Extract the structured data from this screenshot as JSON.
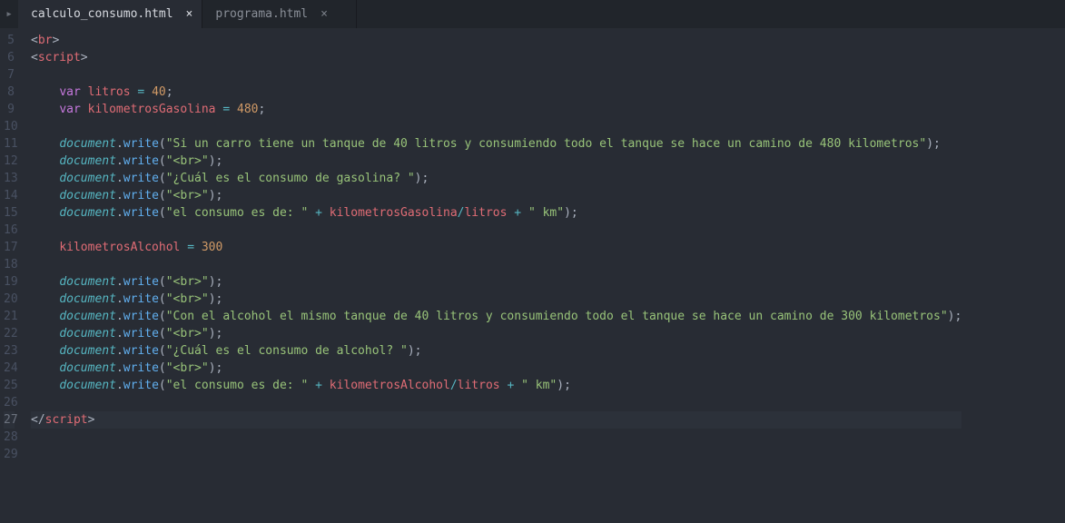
{
  "tabs": {
    "indicator": "▸",
    "items": [
      {
        "label": "calculo_consumo.html",
        "active": true
      },
      {
        "label": "programa.html",
        "active": false
      }
    ],
    "closeGlyph": "×"
  },
  "editor": {
    "startLine": 5,
    "currentLine": 27,
    "lines": [
      {
        "n": 5,
        "tokens": [
          [
            "br",
            "<"
          ],
          [
            "tg",
            "br"
          ],
          [
            "br",
            ">"
          ]
        ]
      },
      {
        "n": 6,
        "tokens": [
          [
            "br",
            "<"
          ],
          [
            "tg",
            "script"
          ],
          [
            "br",
            ">"
          ]
        ]
      },
      {
        "n": 7,
        "tokens": []
      },
      {
        "n": 8,
        "tokens": [
          [
            "p",
            "    "
          ],
          [
            "kw",
            "var"
          ],
          [
            "p",
            " "
          ],
          [
            "id",
            "litros"
          ],
          [
            "p",
            " "
          ],
          [
            "op",
            "="
          ],
          [
            "p",
            " "
          ],
          [
            "nu",
            "40"
          ],
          [
            "p",
            ";"
          ]
        ]
      },
      {
        "n": 9,
        "tokens": [
          [
            "p",
            "    "
          ],
          [
            "kw",
            "var"
          ],
          [
            "p",
            " "
          ],
          [
            "id",
            "kilometrosGasolina"
          ],
          [
            "p",
            " "
          ],
          [
            "op",
            "="
          ],
          [
            "p",
            " "
          ],
          [
            "nu",
            "480"
          ],
          [
            "p",
            ";"
          ]
        ]
      },
      {
        "n": 10,
        "tokens": []
      },
      {
        "n": 11,
        "tokens": [
          [
            "p",
            "    "
          ],
          [
            "obj",
            "document"
          ],
          [
            "p",
            "."
          ],
          [
            "fn",
            "write"
          ],
          [
            "p",
            "("
          ],
          [
            "st",
            "\"Si un carro tiene un tanque de 40 litros y consumiendo todo el tanque se hace un camino de 480 kilometros\""
          ],
          [
            "p",
            ");"
          ]
        ]
      },
      {
        "n": 12,
        "tokens": [
          [
            "p",
            "    "
          ],
          [
            "obj",
            "document"
          ],
          [
            "p",
            "."
          ],
          [
            "fn",
            "write"
          ],
          [
            "p",
            "("
          ],
          [
            "st",
            "\"<br>\""
          ],
          [
            "p",
            ");"
          ]
        ]
      },
      {
        "n": 13,
        "tokens": [
          [
            "p",
            "    "
          ],
          [
            "obj",
            "document"
          ],
          [
            "p",
            "."
          ],
          [
            "fn",
            "write"
          ],
          [
            "p",
            "("
          ],
          [
            "st",
            "\"¿Cuál es el consumo de gasolina? \""
          ],
          [
            "p",
            ");"
          ]
        ]
      },
      {
        "n": 14,
        "tokens": [
          [
            "p",
            "    "
          ],
          [
            "obj",
            "document"
          ],
          [
            "p",
            "."
          ],
          [
            "fn",
            "write"
          ],
          [
            "p",
            "("
          ],
          [
            "st",
            "\"<br>\""
          ],
          [
            "p",
            ");"
          ]
        ]
      },
      {
        "n": 15,
        "tokens": [
          [
            "p",
            "    "
          ],
          [
            "obj",
            "document"
          ],
          [
            "p",
            "."
          ],
          [
            "fn",
            "write"
          ],
          [
            "p",
            "("
          ],
          [
            "st",
            "\"el consumo es de: \""
          ],
          [
            "p",
            " "
          ],
          [
            "op",
            "+"
          ],
          [
            "p",
            " "
          ],
          [
            "id",
            "kilometrosGasolina"
          ],
          [
            "op",
            "/"
          ],
          [
            "id",
            "litros"
          ],
          [
            "p",
            " "
          ],
          [
            "op",
            "+"
          ],
          [
            "p",
            " "
          ],
          [
            "st",
            "\" km\""
          ],
          [
            "p",
            ");"
          ]
        ]
      },
      {
        "n": 16,
        "tokens": []
      },
      {
        "n": 17,
        "tokens": [
          [
            "p",
            "    "
          ],
          [
            "id",
            "kilometrosAlcohol"
          ],
          [
            "p",
            " "
          ],
          [
            "op",
            "="
          ],
          [
            "p",
            " "
          ],
          [
            "nu",
            "300"
          ]
        ]
      },
      {
        "n": 18,
        "tokens": []
      },
      {
        "n": 19,
        "tokens": [
          [
            "p",
            "    "
          ],
          [
            "obj",
            "document"
          ],
          [
            "p",
            "."
          ],
          [
            "fn",
            "write"
          ],
          [
            "p",
            "("
          ],
          [
            "st",
            "\"<br>\""
          ],
          [
            "p",
            ");"
          ]
        ]
      },
      {
        "n": 20,
        "tokens": [
          [
            "p",
            "    "
          ],
          [
            "obj",
            "document"
          ],
          [
            "p",
            "."
          ],
          [
            "fn",
            "write"
          ],
          [
            "p",
            "("
          ],
          [
            "st",
            "\"<br>\""
          ],
          [
            "p",
            ");"
          ]
        ]
      },
      {
        "n": 21,
        "tokens": [
          [
            "p",
            "    "
          ],
          [
            "obj",
            "document"
          ],
          [
            "p",
            "."
          ],
          [
            "fn",
            "write"
          ],
          [
            "p",
            "("
          ],
          [
            "st",
            "\"Con el alcohol el mismo tanque de 40 litros y consumiendo todo el tanque se hace un camino de 300 kilometros\""
          ],
          [
            "p",
            ");"
          ]
        ]
      },
      {
        "n": 22,
        "tokens": [
          [
            "p",
            "    "
          ],
          [
            "obj",
            "document"
          ],
          [
            "p",
            "."
          ],
          [
            "fn",
            "write"
          ],
          [
            "p",
            "("
          ],
          [
            "st",
            "\"<br>\""
          ],
          [
            "p",
            ");"
          ]
        ]
      },
      {
        "n": 23,
        "tokens": [
          [
            "p",
            "    "
          ],
          [
            "obj",
            "document"
          ],
          [
            "p",
            "."
          ],
          [
            "fn",
            "write"
          ],
          [
            "p",
            "("
          ],
          [
            "st",
            "\"¿Cuál es el consumo de alcohol? \""
          ],
          [
            "p",
            ");"
          ]
        ]
      },
      {
        "n": 24,
        "tokens": [
          [
            "p",
            "    "
          ],
          [
            "obj",
            "document"
          ],
          [
            "p",
            "."
          ],
          [
            "fn",
            "write"
          ],
          [
            "p",
            "("
          ],
          [
            "st",
            "\"<br>\""
          ],
          [
            "p",
            ");"
          ]
        ]
      },
      {
        "n": 25,
        "tokens": [
          [
            "p",
            "    "
          ],
          [
            "obj",
            "document"
          ],
          [
            "p",
            "."
          ],
          [
            "fn",
            "write"
          ],
          [
            "p",
            "("
          ],
          [
            "st",
            "\"el consumo es de: \""
          ],
          [
            "p",
            " "
          ],
          [
            "op",
            "+"
          ],
          [
            "p",
            " "
          ],
          [
            "id",
            "kilometrosAlcohol"
          ],
          [
            "op",
            "/"
          ],
          [
            "id",
            "litros"
          ],
          [
            "p",
            " "
          ],
          [
            "op",
            "+"
          ],
          [
            "p",
            " "
          ],
          [
            "st",
            "\" km\""
          ],
          [
            "p",
            ");"
          ]
        ]
      },
      {
        "n": 26,
        "tokens": []
      },
      {
        "n": 27,
        "tokens": [
          [
            "br",
            "</"
          ],
          [
            "tg",
            "script"
          ],
          [
            "br",
            ">"
          ]
        ]
      },
      {
        "n": 28,
        "tokens": []
      },
      {
        "n": 29,
        "tokens": []
      }
    ]
  }
}
